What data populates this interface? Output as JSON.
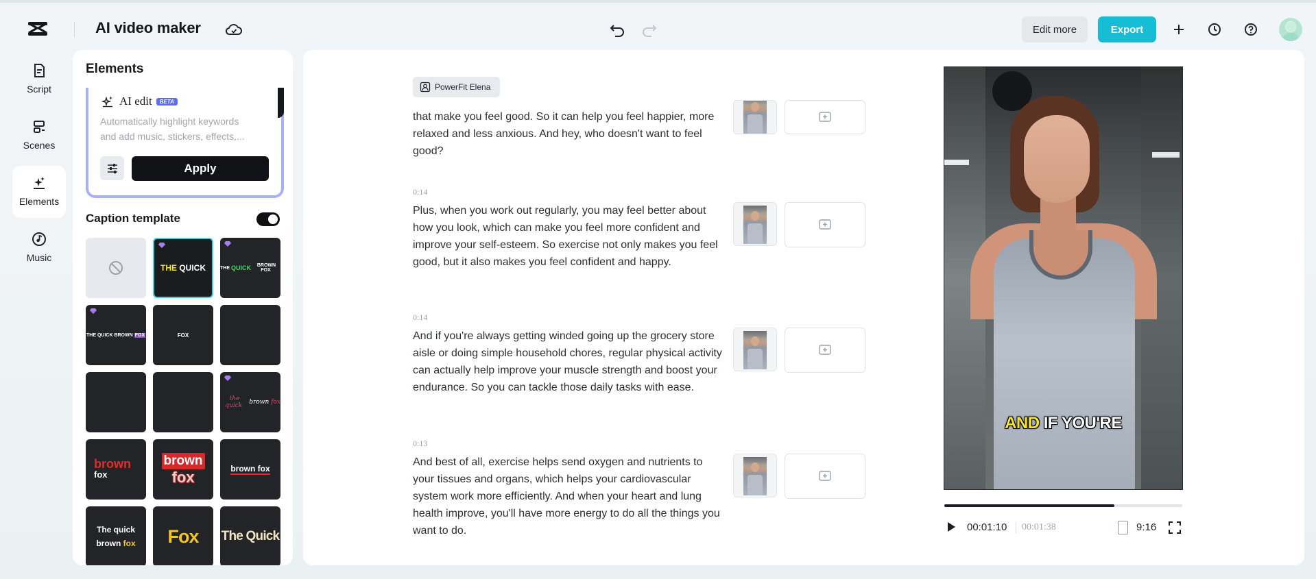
{
  "header": {
    "app_title": "AI video maker",
    "edit_more_label": "Edit more",
    "export_label": "Export",
    "icons": [
      "capcut-logo-icon",
      "cloud-sync-icon",
      "undo-icon",
      "redo-icon",
      "plus-icon",
      "history-icon",
      "help-icon",
      "avatar"
    ]
  },
  "sidebar": {
    "items": [
      {
        "label": "Script",
        "icon": "script-icon",
        "active": false
      },
      {
        "label": "Scenes",
        "icon": "scenes-icon",
        "active": false
      },
      {
        "label": "Elements",
        "icon": "elements-icon",
        "active": true
      },
      {
        "label": "Music",
        "icon": "music-icon",
        "active": false
      }
    ]
  },
  "panel": {
    "title": "Elements",
    "ai_edit": {
      "title": "AI edit",
      "badge": "BETA",
      "desc_line1": "Automatically highlight keywords",
      "desc_line2": "and add music, stickers, effects,...",
      "apply_label": "Apply"
    },
    "caption_template": {
      "title": "Caption template",
      "enabled": true,
      "tiles": [
        {
          "text": "",
          "style": "none"
        },
        {
          "text": "THE QUICK",
          "style": "yellow-white",
          "selected": true,
          "premium": true
        },
        {
          "text": "THE QUICK BROWN FOX",
          "style": "green-highlight",
          "premium": true
        },
        {
          "text": "THE QUICK BROWN FOX",
          "style": "purple-box",
          "premium": true
        },
        {
          "text": "FOX",
          "style": "plain-small"
        },
        {
          "text": "",
          "style": "blank"
        },
        {
          "text": "",
          "style": "blank"
        },
        {
          "text": "",
          "style": "blank"
        },
        {
          "text": "the quick brown fox",
          "style": "red-script",
          "premium": true
        },
        {
          "text": "brown fox",
          "style": "red-bold"
        },
        {
          "text": "brown fox",
          "style": "red-box-white"
        },
        {
          "text": "brown fox",
          "style": "underline"
        },
        {
          "text": "The quick brown fox",
          "style": "two-line-yellow"
        },
        {
          "text": "Fox",
          "style": "yellow-impact"
        },
        {
          "text": "The Quick",
          "style": "cream-impact"
        }
      ]
    }
  },
  "script": {
    "speaker": "PowerFit Elena",
    "segments": [
      {
        "time": "",
        "text": "that make you feel good. So it can help you feel happier, more relaxed and less anxious. And hey, who doesn't want to feel good?"
      },
      {
        "time": "0:14",
        "text": "Plus, when you work out regularly, you may feel better about how you look, which can make you feel more confident and improve your self-esteem. So exercise not only makes you feel good, but it also makes you feel confident and happy."
      },
      {
        "time": "0:14",
        "text": "And if you're always getting winded going up the grocery store aisle or doing simple household chores, regular physical activity can actually help improve your muscle strength and boost your endurance. So you can tackle those daily tasks with ease."
      },
      {
        "time": "0:13",
        "text": "And best of all, exercise helps send oxygen and nutrients to your tissues and organs, which helps your cardiovascular system work more efficiently. And when your heart and lung health improve, you'll have more energy to do all the things you want to do."
      }
    ]
  },
  "preview": {
    "caption_highlight": "AND",
    "caption_rest": " IF YOU'RE",
    "current_time": "00:01:10",
    "total_time": "00:01:38",
    "progress": 0.714,
    "aspect_ratio": "9:16"
  },
  "colors": {
    "accent": "#17bcd5",
    "ai_card_border": "#a9b0f9",
    "beta_badge": "#5b6cf5",
    "caption_highlight": "#f6e33a"
  }
}
